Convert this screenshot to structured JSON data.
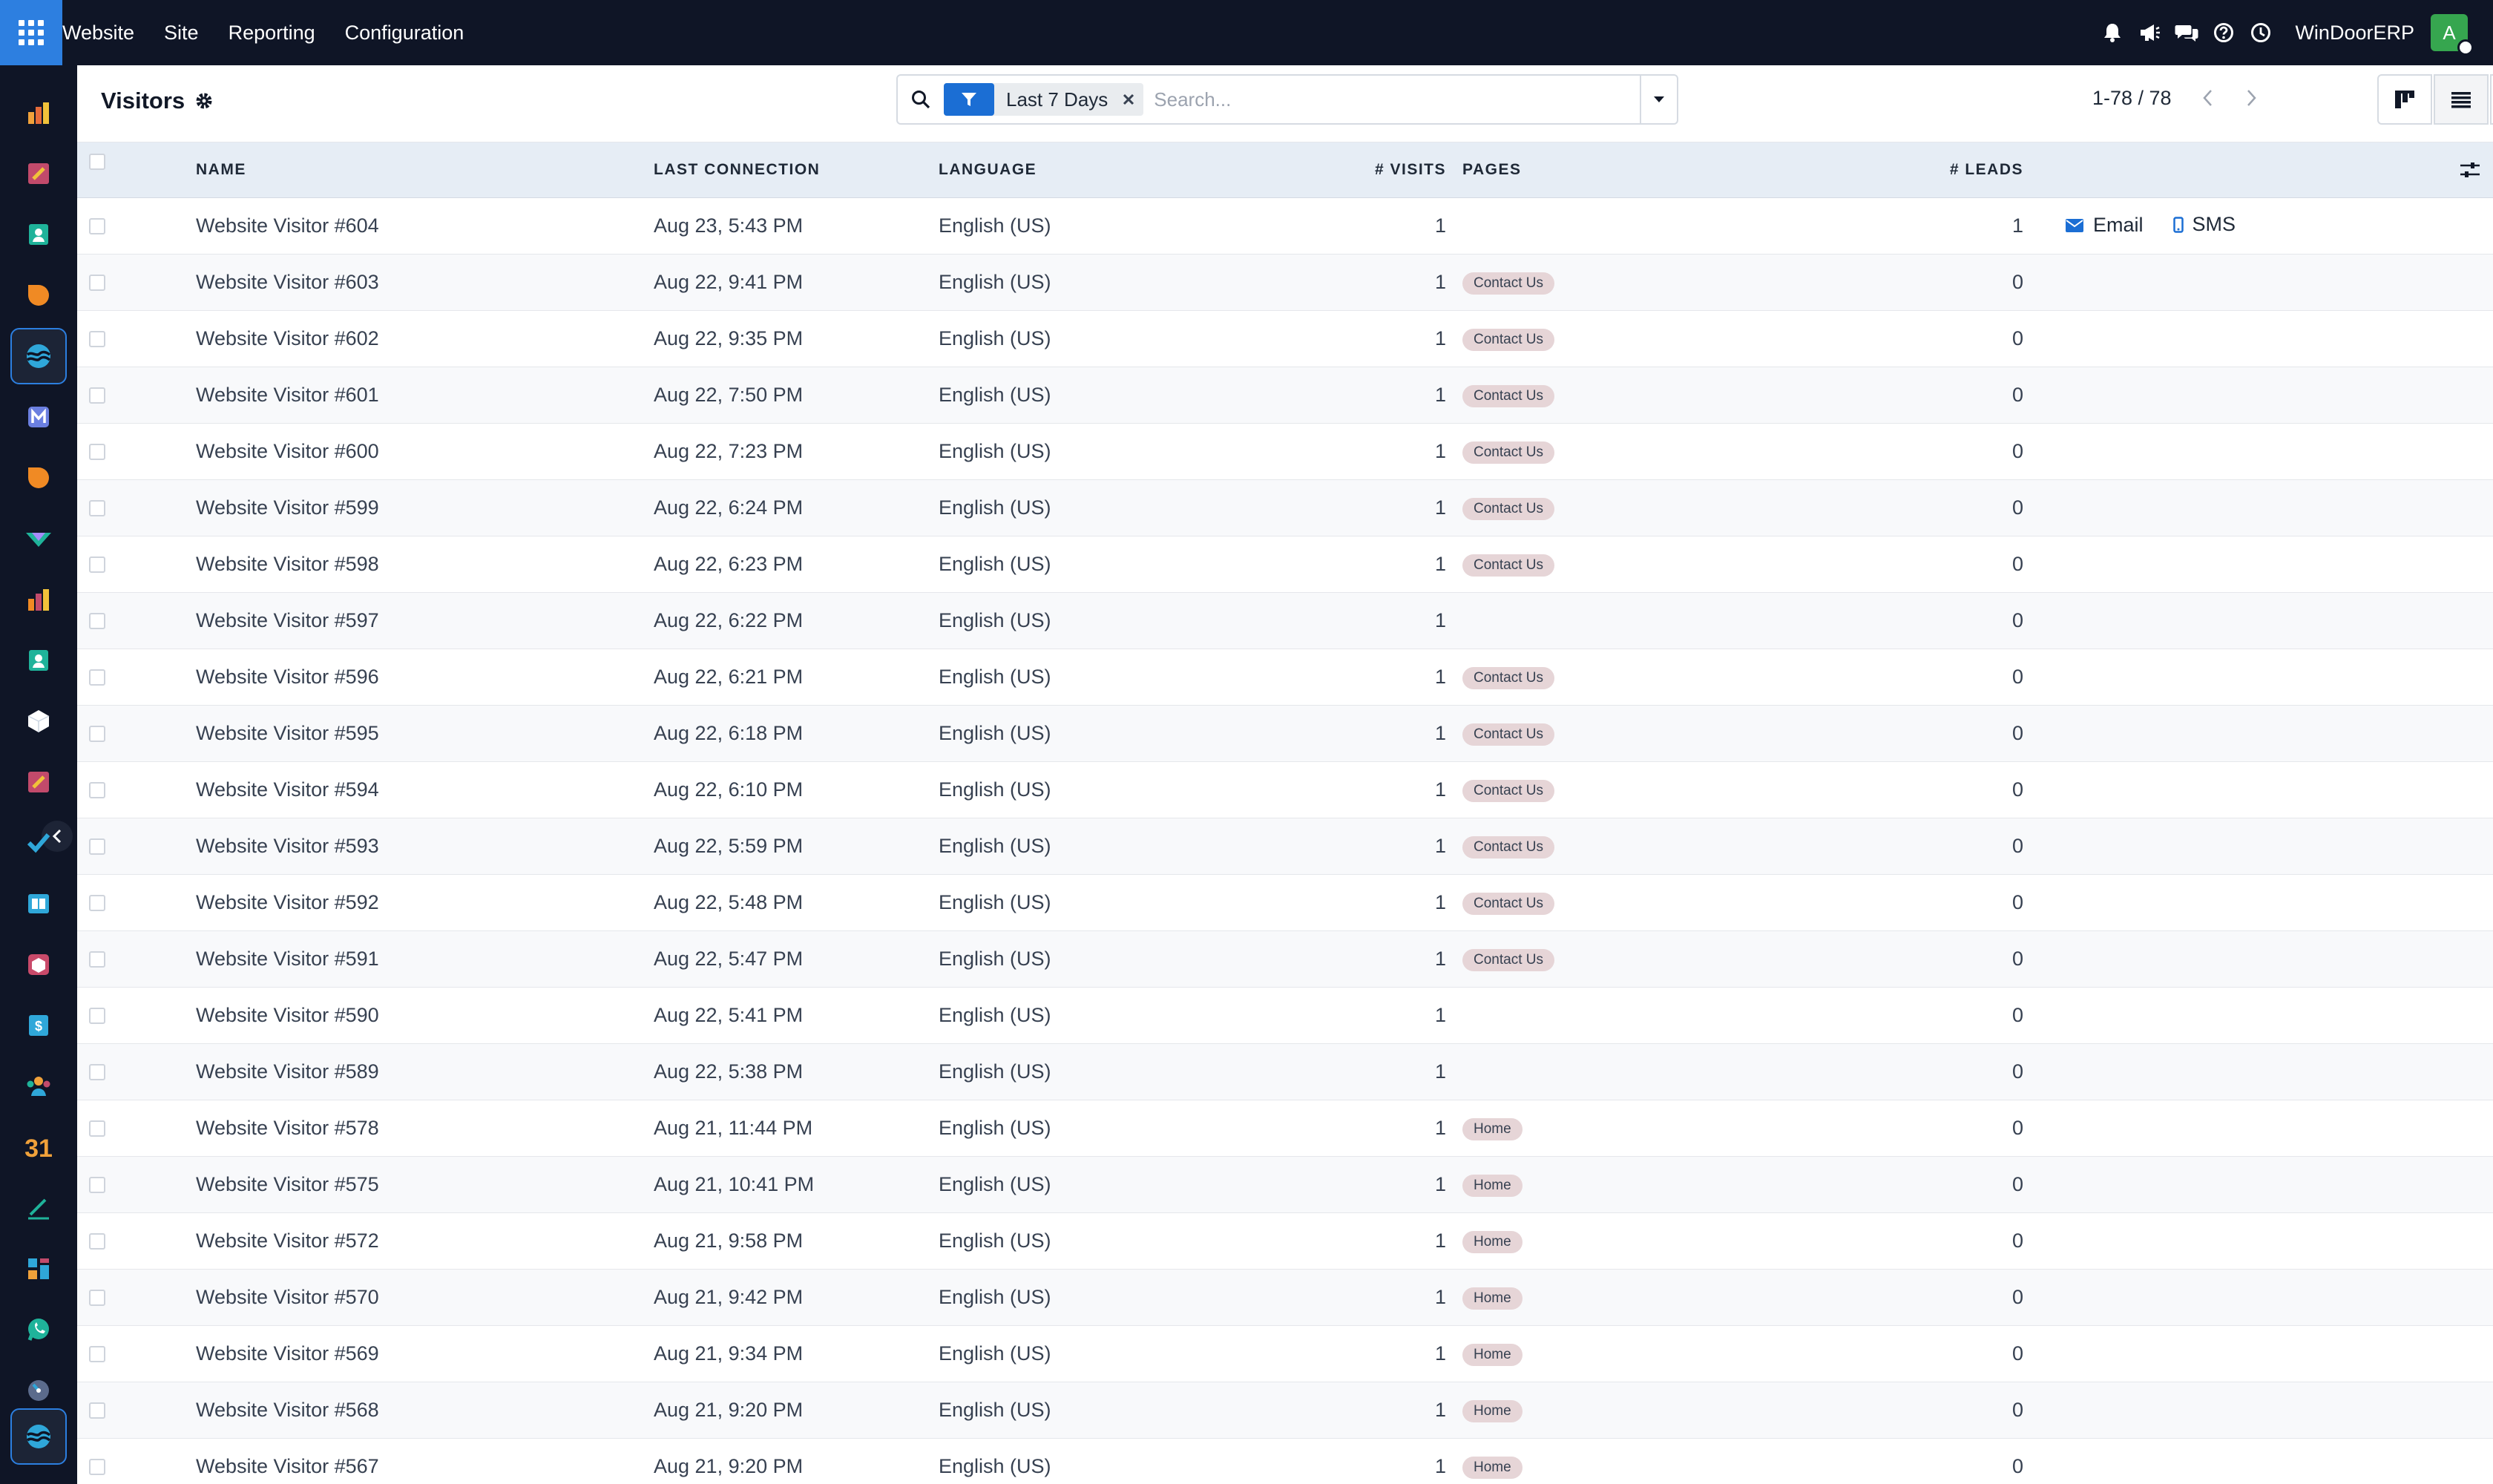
{
  "topbar": {
    "menu": [
      "Website",
      "Site",
      "Reporting",
      "Configuration"
    ],
    "company": "WinDoorERP",
    "avatar_initial": "A",
    "icons": [
      "bell-icon",
      "megaphone-icon",
      "chat-icon",
      "help-icon",
      "clock-icon"
    ]
  },
  "rail": {
    "apps": [
      {
        "icon": "dashboards-icon",
        "color": "#f0a13a"
      },
      {
        "icon": "notes-icon",
        "color": "#f0a13a"
      },
      {
        "icon": "contacts-icon",
        "color": "#1fb39a"
      },
      {
        "icon": "crm-icon",
        "color": "#f08a24"
      },
      {
        "icon": "website-icon",
        "color": "#2fa7d9",
        "active": true
      },
      {
        "icon": "email-marketing-icon",
        "color": "#6b7fe0"
      },
      {
        "icon": "discuss-icon",
        "color": "#f08a24"
      },
      {
        "icon": "sales-icon",
        "color": "#1fb39a"
      },
      {
        "icon": "reports-icon",
        "color": "#f08a24"
      },
      {
        "icon": "employees-icon",
        "color": "#1fb39a"
      },
      {
        "icon": "inventory-icon",
        "color": "#ffffff"
      },
      {
        "icon": "project-icon",
        "color": "#f0a13a"
      },
      {
        "icon": "todo-icon",
        "color": "#2fa7d9"
      },
      {
        "icon": "knowledge-icon",
        "color": "#2fa7d9"
      },
      {
        "icon": "cube-icon",
        "color": "#c94a6a"
      },
      {
        "icon": "invoicing-icon",
        "color": "#2fa7d9"
      },
      {
        "icon": "team-icon",
        "color": "#f0a13a"
      },
      {
        "icon": "calendar-icon",
        "color": "#f0a13a"
      },
      {
        "icon": "sign-icon",
        "color": "#1fb39a"
      },
      {
        "icon": "apps-icon",
        "color": "#2fa7d9"
      },
      {
        "icon": "whatsapp-icon",
        "color": "#1fb39a"
      },
      {
        "icon": "timesheet-icon",
        "color": "#2fa7d9"
      },
      {
        "icon": "website-icon",
        "color": "#2fa7d9",
        "active": true
      }
    ]
  },
  "control": {
    "title": "Visitors",
    "facet_label": "Last 7 Days",
    "search_placeholder": "Search...",
    "pager": "1-78 / 78"
  },
  "table": {
    "headers": {
      "name": "NAME",
      "last_connection": "LAST CONNECTION",
      "language": "LANGUAGE",
      "visits": "# VISITS",
      "pages": "PAGES",
      "leads": "# LEADS"
    },
    "actions": {
      "email": "Email",
      "sms": "SMS"
    },
    "rows": [
      {
        "name": "Website Visitor #604",
        "last": "Aug 23, 5:43 PM",
        "lang": "English (US)",
        "visits": "1",
        "page": "",
        "leads": "1",
        "actions": true
      },
      {
        "name": "Website Visitor #603",
        "last": "Aug 22, 9:41 PM",
        "lang": "English (US)",
        "visits": "1",
        "page": "Contact Us",
        "leads": "0"
      },
      {
        "name": "Website Visitor #602",
        "last": "Aug 22, 9:35 PM",
        "lang": "English (US)",
        "visits": "1",
        "page": "Contact Us",
        "leads": "0"
      },
      {
        "name": "Website Visitor #601",
        "last": "Aug 22, 7:50 PM",
        "lang": "English (US)",
        "visits": "1",
        "page": "Contact Us",
        "leads": "0"
      },
      {
        "name": "Website Visitor #600",
        "last": "Aug 22, 7:23 PM",
        "lang": "English (US)",
        "visits": "1",
        "page": "Contact Us",
        "leads": "0"
      },
      {
        "name": "Website Visitor #599",
        "last": "Aug 22, 6:24 PM",
        "lang": "English (US)",
        "visits": "1",
        "page": "Contact Us",
        "leads": "0"
      },
      {
        "name": "Website Visitor #598",
        "last": "Aug 22, 6:23 PM",
        "lang": "English (US)",
        "visits": "1",
        "page": "Contact Us",
        "leads": "0"
      },
      {
        "name": "Website Visitor #597",
        "last": "Aug 22, 6:22 PM",
        "lang": "English (US)",
        "visits": "1",
        "page": "",
        "leads": "0"
      },
      {
        "name": "Website Visitor #596",
        "last": "Aug 22, 6:21 PM",
        "lang": "English (US)",
        "visits": "1",
        "page": "Contact Us",
        "leads": "0"
      },
      {
        "name": "Website Visitor #595",
        "last": "Aug 22, 6:18 PM",
        "lang": "English (US)",
        "visits": "1",
        "page": "Contact Us",
        "leads": "0"
      },
      {
        "name": "Website Visitor #594",
        "last": "Aug 22, 6:10 PM",
        "lang": "English (US)",
        "visits": "1",
        "page": "Contact Us",
        "leads": "0"
      },
      {
        "name": "Website Visitor #593",
        "last": "Aug 22, 5:59 PM",
        "lang": "English (US)",
        "visits": "1",
        "page": "Contact Us",
        "leads": "0"
      },
      {
        "name": "Website Visitor #592",
        "last": "Aug 22, 5:48 PM",
        "lang": "English (US)",
        "visits": "1",
        "page": "Contact Us",
        "leads": "0"
      },
      {
        "name": "Website Visitor #591",
        "last": "Aug 22, 5:47 PM",
        "lang": "English (US)",
        "visits": "1",
        "page": "Contact Us",
        "leads": "0"
      },
      {
        "name": "Website Visitor #590",
        "last": "Aug 22, 5:41 PM",
        "lang": "English (US)",
        "visits": "1",
        "page": "",
        "leads": "0"
      },
      {
        "name": "Website Visitor #589",
        "last": "Aug 22, 5:38 PM",
        "lang": "English (US)",
        "visits": "1",
        "page": "",
        "leads": "0"
      },
      {
        "name": "Website Visitor #578",
        "last": "Aug 21, 11:44 PM",
        "lang": "English (US)",
        "visits": "1",
        "page": "Home",
        "leads": "0"
      },
      {
        "name": "Website Visitor #575",
        "last": "Aug 21, 10:41 PM",
        "lang": "English (US)",
        "visits": "1",
        "page": "Home",
        "leads": "0"
      },
      {
        "name": "Website Visitor #572",
        "last": "Aug 21, 9:58 PM",
        "lang": "English (US)",
        "visits": "1",
        "page": "Home",
        "leads": "0"
      },
      {
        "name": "Website Visitor #570",
        "last": "Aug 21, 9:42 PM",
        "lang": "English (US)",
        "visits": "1",
        "page": "Home",
        "leads": "0"
      },
      {
        "name": "Website Visitor #569",
        "last": "Aug 21, 9:34 PM",
        "lang": "English (US)",
        "visits": "1",
        "page": "Home",
        "leads": "0"
      },
      {
        "name": "Website Visitor #568",
        "last": "Aug 21, 9:20 PM",
        "lang": "English (US)",
        "visits": "1",
        "page": "Home",
        "leads": "0"
      },
      {
        "name": "Website Visitor #567",
        "last": "Aug 21, 9:20 PM",
        "lang": "English (US)",
        "visits": "1",
        "page": "Home",
        "leads": "0"
      }
    ]
  }
}
